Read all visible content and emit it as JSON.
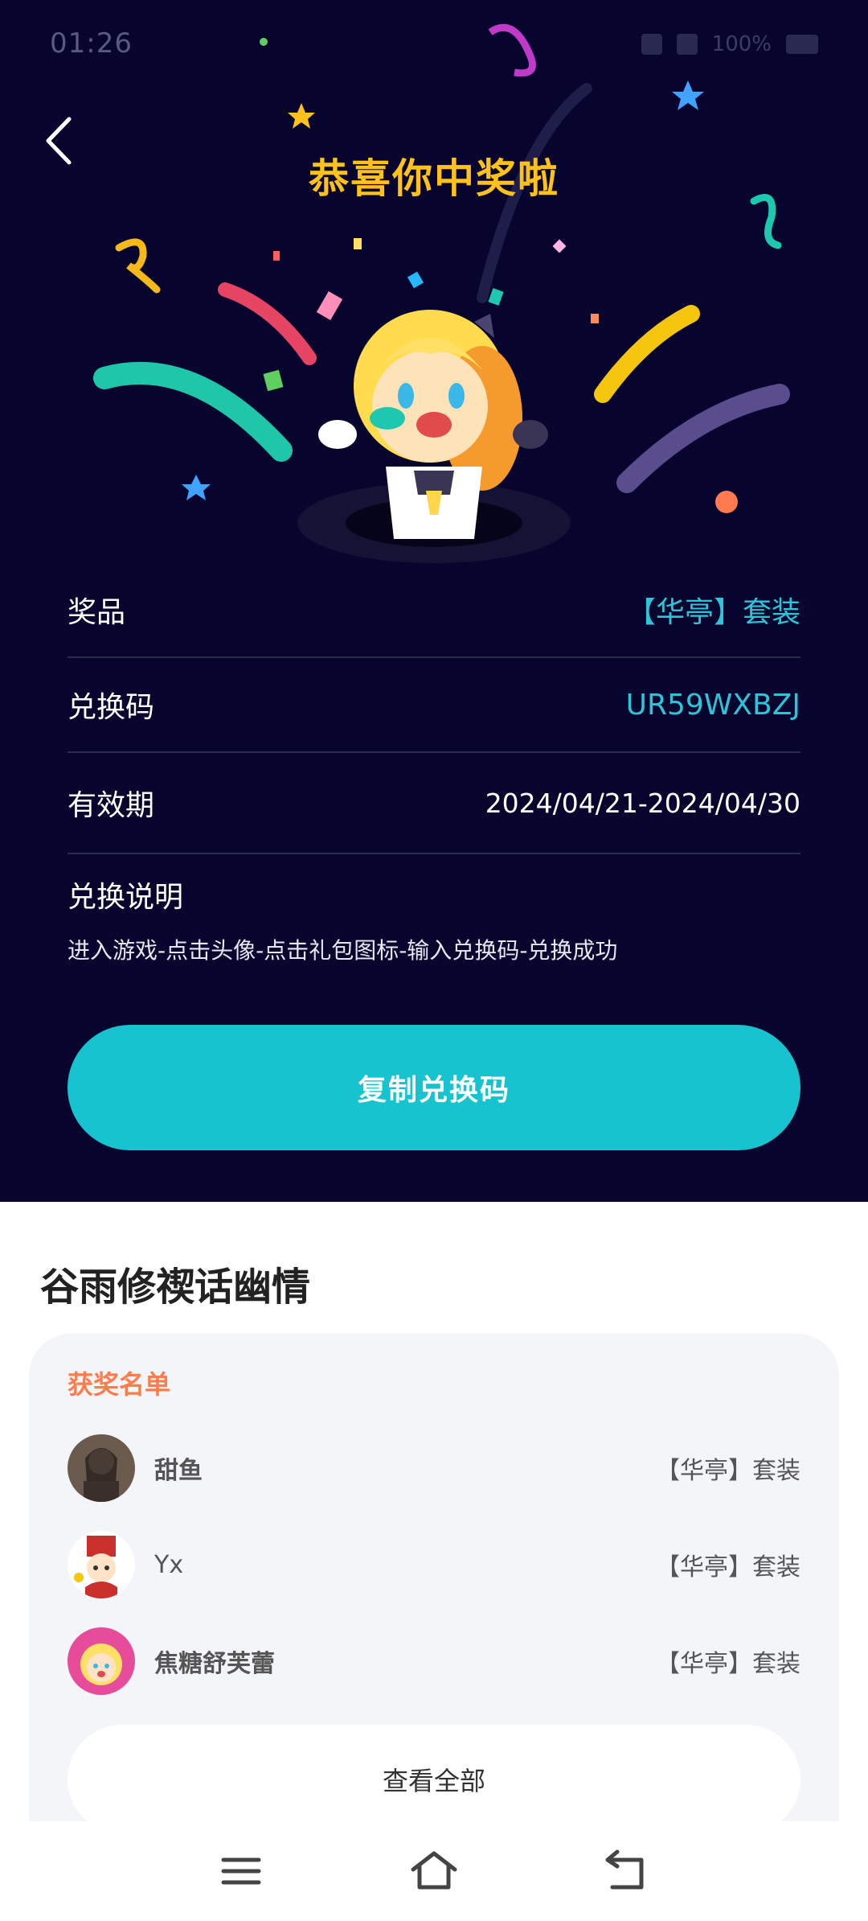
{
  "status": {
    "time": "01:26",
    "battery": "100%"
  },
  "header": {
    "title": "恭喜你中奖啦"
  },
  "details": {
    "prize_label": "奖品",
    "prize_value": "【华亭】套装",
    "code_label": "兑换码",
    "code_value": "UR59WXBZJ",
    "validity_label": "有效期",
    "validity_value": "2024/04/21-2024/04/30"
  },
  "instructions": {
    "title": "兑换说明",
    "text": "进入游戏-点击头像-点击礼包图标-输入兑换码-兑换成功"
  },
  "copy_button": "复制兑换码",
  "event": {
    "title": "谷雨修禊话幽情"
  },
  "winners": {
    "title": "获奖名单",
    "list": [
      {
        "name": "甜鱼",
        "prize": "【华亭】套装"
      },
      {
        "name": "Yx",
        "prize": "【华亭】套装"
      },
      {
        "name": "焦糖舒芙蕾",
        "prize": "【华亭】套装"
      }
    ],
    "view_all": "查看全部"
  },
  "colors": {
    "background": "#07052e",
    "accent": "#16c3cf",
    "title": "#ffc21a",
    "highlight": "#2cc4d6",
    "winners_title": "#ff7d4c"
  }
}
